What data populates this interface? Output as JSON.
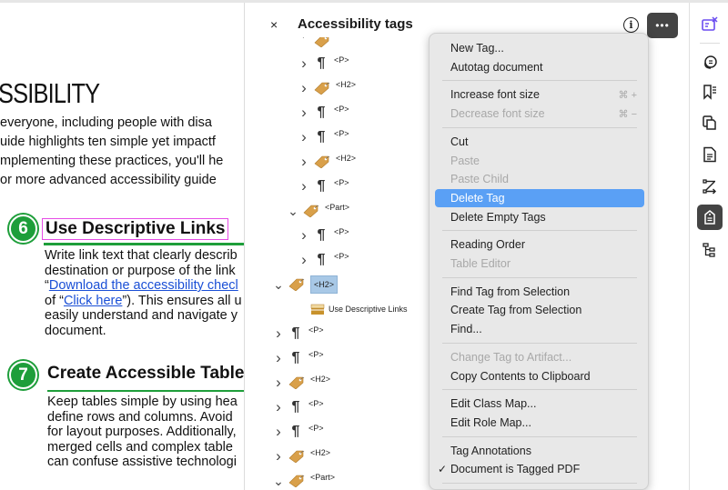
{
  "document": {
    "title": "SSIBILITY",
    "intro_lines": [
      "everyone, including people with disa",
      "uide highlights ten simple yet impactf",
      "mplementing these practices, you'll he",
      "or more advanced accessibility guide"
    ],
    "sections": [
      {
        "number": "6",
        "heading": "Use Descriptive Links",
        "body_lines": [
          "Write link text that clearly describ",
          "destination or purpose of the link"
        ],
        "link_line_prefix": "“",
        "link_text": "Download the accessibility checl",
        "line4_prefix": "of “",
        "link2_text": "Click here",
        "line4_suffix": "”). This ensures all u",
        "body_lines_after": [
          "easily understand and navigate y",
          "document."
        ]
      },
      {
        "number": "7",
        "heading": "Create Accessible Table",
        "body_lines": [
          "Keep tables simple by using hea",
          "define rows and columns. Avoid",
          "for layout purposes. Additionally,",
          "merged cells and complex table",
          "can confuse assistive technologi"
        ]
      }
    ]
  },
  "panel": {
    "title": "Accessibility tags",
    "close_label": "×",
    "info_label": "i",
    "more_label": "•••",
    "tree": [
      {
        "indent": 1,
        "expand": "partial",
        "icon": "tag",
        "label": ""
      },
      {
        "indent": 1,
        "expand": "collapsed",
        "icon": "paragraph",
        "label": "<P>"
      },
      {
        "indent": 1,
        "expand": "collapsed",
        "icon": "tag",
        "label": "<H2>"
      },
      {
        "indent": 1,
        "expand": "collapsed",
        "icon": "paragraph",
        "label": "<P>"
      },
      {
        "indent": 1,
        "expand": "collapsed",
        "icon": "paragraph",
        "label": "<P>"
      },
      {
        "indent": 1,
        "expand": "collapsed",
        "icon": "tag",
        "label": "<H2>"
      },
      {
        "indent": 1,
        "expand": "collapsed",
        "icon": "paragraph",
        "label": "<P>"
      },
      {
        "indent": 0.5,
        "expand": "expanded",
        "icon": "tag",
        "label": "<Part>"
      },
      {
        "indent": 1,
        "expand": "collapsed",
        "icon": "paragraph",
        "label": "<P>"
      },
      {
        "indent": 1,
        "expand": "collapsed",
        "icon": "paragraph",
        "label": "<P>"
      },
      {
        "indent": 0,
        "expand": "expanded",
        "icon": "tag",
        "label": "<H2>",
        "selected": true
      },
      {
        "indent": 1,
        "expand": "none",
        "icon": "content",
        "label": "Use Descriptive Links"
      },
      {
        "indent": 0,
        "expand": "collapsed",
        "icon": "paragraph",
        "label": "<P>"
      },
      {
        "indent": 0,
        "expand": "collapsed",
        "icon": "paragraph",
        "label": "<P>"
      },
      {
        "indent": 0,
        "expand": "collapsed",
        "icon": "tag",
        "label": "<H2>"
      },
      {
        "indent": 0,
        "expand": "collapsed",
        "icon": "paragraph",
        "label": "<P>"
      },
      {
        "indent": 0,
        "expand": "collapsed",
        "icon": "paragraph",
        "label": "<P>"
      },
      {
        "indent": 0,
        "expand": "collapsed",
        "icon": "tag",
        "label": "<H2>"
      },
      {
        "indent": 0,
        "expand": "expanded",
        "icon": "tag",
        "label": "<Part>"
      }
    ]
  },
  "context_menu": {
    "items": [
      {
        "label": "New Tag...",
        "enabled": true
      },
      {
        "label": "Autotag document",
        "enabled": true
      },
      {
        "separator": true
      },
      {
        "label": "Increase font size",
        "enabled": true,
        "shortcut": "⌘ +"
      },
      {
        "label": "Decrease font size",
        "enabled": false,
        "shortcut": "⌘ −"
      },
      {
        "separator": true
      },
      {
        "label": "Cut",
        "enabled": true
      },
      {
        "label": "Paste",
        "enabled": false
      },
      {
        "label": "Paste Child",
        "enabled": false
      },
      {
        "label": "Delete Tag",
        "enabled": true,
        "highlighted": true
      },
      {
        "label": "Delete Empty Tags",
        "enabled": true
      },
      {
        "separator": true
      },
      {
        "label": "Reading Order",
        "enabled": true
      },
      {
        "label": "Table Editor",
        "enabled": false
      },
      {
        "separator": true
      },
      {
        "label": "Find Tag from Selection",
        "enabled": true
      },
      {
        "label": "Create Tag from Selection",
        "enabled": true
      },
      {
        "label": "Find...",
        "enabled": true
      },
      {
        "separator": true
      },
      {
        "label": "Change Tag to Artifact...",
        "enabled": false
      },
      {
        "label": "Copy Contents to Clipboard",
        "enabled": true
      },
      {
        "separator": true
      },
      {
        "label": "Edit Class Map...",
        "enabled": true
      },
      {
        "label": "Edit Role Map...",
        "enabled": true
      },
      {
        "separator": true
      },
      {
        "label": "Tag Annotations",
        "enabled": true
      },
      {
        "label": "Document is Tagged PDF",
        "enabled": true,
        "checked": true
      },
      {
        "separator": true
      }
    ]
  },
  "right_rail": {
    "tools": [
      {
        "name": "accessibility-checker-icon",
        "active": false,
        "accent": true
      },
      {
        "name": "comments-icon",
        "active": false
      },
      {
        "name": "bookmarks-icon",
        "active": false
      },
      {
        "name": "pages-icon",
        "active": false
      },
      {
        "name": "document-properties-icon",
        "active": false
      },
      {
        "name": "reading-order-icon",
        "active": false
      },
      {
        "name": "tags-icon",
        "active": true
      },
      {
        "name": "content-tree-icon",
        "active": false
      }
    ]
  },
  "colors": {
    "accent_green": "#1e9e3a",
    "highlight_blue": "#5aa0f5",
    "link_blue": "#1a4fd6",
    "selection_magenta": "#e64ce6",
    "tag_gold": "#d9a04a",
    "rail_accent": "#6a4cf0"
  }
}
